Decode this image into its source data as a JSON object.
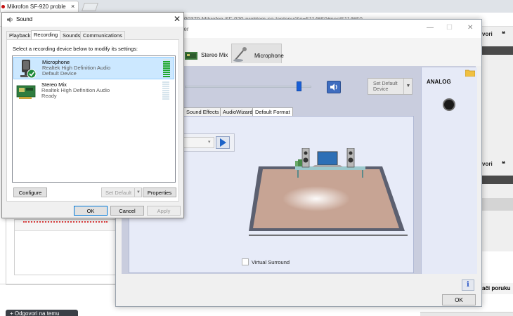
{
  "browser": {
    "tab_title": "Mikrofon SF-920 proble",
    "tab_close": "×",
    "url_fragment": "00379-Mikrofon-SF-920-problem-na-laptopu/&p=5114650#post5114650",
    "right_buttons": [
      {
        "label": "vori",
        "icon": "quote"
      },
      {
        "label": "vori",
        "icon": "quote"
      }
    ],
    "reply_thread_btn": "ači poruku",
    "reply_btn": "+ Odgovori na temu"
  },
  "realtek": {
    "title": "ger",
    "controls": {
      "minimize": "—",
      "maximize": "☐",
      "close": "✕"
    },
    "devices": [
      {
        "label": "Stereo Mix",
        "icon": "stereo-mix-icon",
        "active": false
      },
      {
        "label": "Microphone",
        "icon": "microphone-icon",
        "active": true
      }
    ],
    "volume_level": 0.93,
    "set_default": {
      "line1": "Set Default",
      "line2": "Device",
      "arrow": "▼"
    },
    "subtabs": [
      "Sound Effects",
      "AudioWizard",
      "Default Format"
    ],
    "active_subtab": 2,
    "environment_label": "n",
    "environment_value": "",
    "environment_arrow": "▾",
    "virtual_surround": {
      "label": "Virtual Surround",
      "checked": false
    },
    "analog_label": "ANALOG",
    "info_glyph": "i",
    "ok_label": "OK"
  },
  "sound": {
    "title": "Sound",
    "close": "✕",
    "tabs": [
      "Playback",
      "Recording",
      "Sounds",
      "Communications"
    ],
    "active_tab": 1,
    "instruction": "Select a recording device below to modify its settings:",
    "devices": [
      {
        "name": "Microphone",
        "driver": "Realtek High Definition Audio",
        "status": "Default Device",
        "selected": true,
        "level": 0.9
      },
      {
        "name": "Stereo Mix",
        "driver": "Realtek High Definition Audio",
        "status": "Ready",
        "selected": false,
        "level": 0.0
      }
    ],
    "configure": "Configure",
    "set_default": "Set Default",
    "set_default_arrow": "▼",
    "properties": "Properties",
    "ok": "OK",
    "cancel": "Cancel",
    "apply": "Apply"
  },
  "colors": {
    "meter_on": "#1fa82e",
    "meter_off": "#d6e4ec",
    "selection": "#cce8ff",
    "accent": "#0078d7"
  }
}
